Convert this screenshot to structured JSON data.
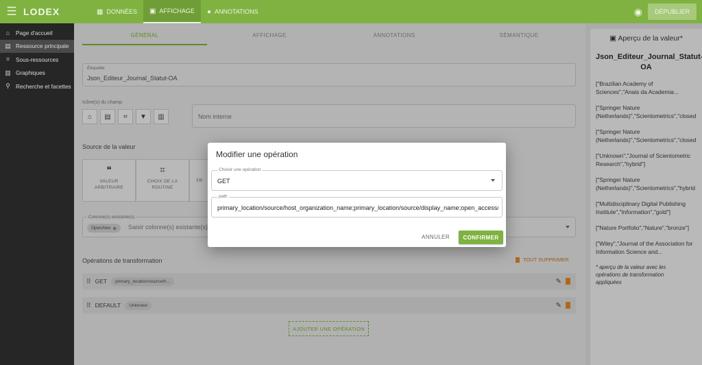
{
  "app": {
    "logo": "LODEX"
  },
  "topnav": [
    {
      "label": "DONNÉES",
      "icon": "table-icon"
    },
    {
      "label": "AFFICHAGE",
      "icon": "display-icon"
    },
    {
      "label": "ANNOTATIONS",
      "icon": "comment-icon"
    }
  ],
  "header": {
    "publish_label": "DÉPUBLIER"
  },
  "sidebar": {
    "items": [
      {
        "label": "Page d'accueil"
      },
      {
        "label": "Ressource principale"
      },
      {
        "label": "Sous-ressources"
      },
      {
        "label": "Graphiques"
      },
      {
        "label": "Recherche et facettes"
      }
    ]
  },
  "subtabs": [
    "GÉNÉRAL",
    "AFFICHAGE",
    "ANNOTATIONS",
    "SÉMANTIQUE"
  ],
  "form": {
    "label_field": {
      "label": "Étiquette",
      "value": "Json_Editeur_Journal_Statut-OA"
    },
    "icons_label": "Icône(s) du champ",
    "internal_name_placeholder": "Nom interne",
    "value_source_title": "Source de la valeur",
    "value_cards": [
      {
        "label1": "VALEUR",
        "label2": "ARBITRAIRE"
      },
      {
        "label1": "CHOIX DE LA",
        "label2": "ROUTINE"
      },
      {
        "label1": "FR",
        "label2": ""
      }
    ],
    "columns_label": "Colonne(s) existante(s)",
    "column_chip": "OpenAlex",
    "columns_placeholder": "Saisir colonne(s) existante(s)"
  },
  "operations": {
    "title": "Opérations de transformation",
    "delete_all": "TOUT SUPPRIMER",
    "rows": [
      {
        "name": "GET",
        "chip": "primary_location/source/h..."
      },
      {
        "name": "DEFAULT",
        "chip": "Unknown"
      }
    ],
    "add_label": "AJOUTER UNE OPÉRATION"
  },
  "preview": {
    "heading": "Aperçu de la valeur*",
    "title_line1": "Json_Editeur_Journal_Statut-",
    "title_line2": "OA",
    "items": [
      {
        "line1": "[\"Brazilian Academy of",
        "line2": "Sciences\",\"Anais da Academia..."
      },
      {
        "line1": "[\"Springer Nature",
        "line2": "(Netherlands)\",\"Scientometrics\",\"closed"
      },
      {
        "line1": "[\"Springer Nature",
        "line2": "(Netherlands)\",\"Scientometrics\",\"closed"
      },
      {
        "line1": "[\"Unknown\",\"Journal of Scientometric",
        "line2": "Research\",\"hybrid\"]"
      },
      {
        "line1": "[\"Springer Nature",
        "line2": "(Netherlands)\",\"Scientometrics\",\"hybrid"
      },
      {
        "line1": "[\"Multidisciplinary Digital Publishing",
        "line2": "Institute\",\"Information\",\"gold\"]"
      },
      {
        "line1": "[\"Nature Portfolio\",\"Nature\",\"bronze\"]",
        "line2": ""
      },
      {
        "line1": "[\"Wiley\",\"Journal of the Association for",
        "line2": "Information Science and..."
      }
    ],
    "note_line1": "* aperçu de la valeur avec les",
    "note_line2": "opérations de transformation",
    "note_line3": "appliquées"
  },
  "dialog": {
    "title": "Modifier une opération",
    "operation_label": "Choisir une opération",
    "operation_value": "GET",
    "path_label": "path",
    "path_value": "primary_location/source/host_organization_name;primary_location/source/display_name;open_access/oa_status",
    "cancel_label": "ANNULER",
    "confirm_label": "CONFIRMER"
  },
  "colors": {
    "accent": "#7fb241",
    "sidebar": "#262626",
    "danger": "#b2671f"
  }
}
